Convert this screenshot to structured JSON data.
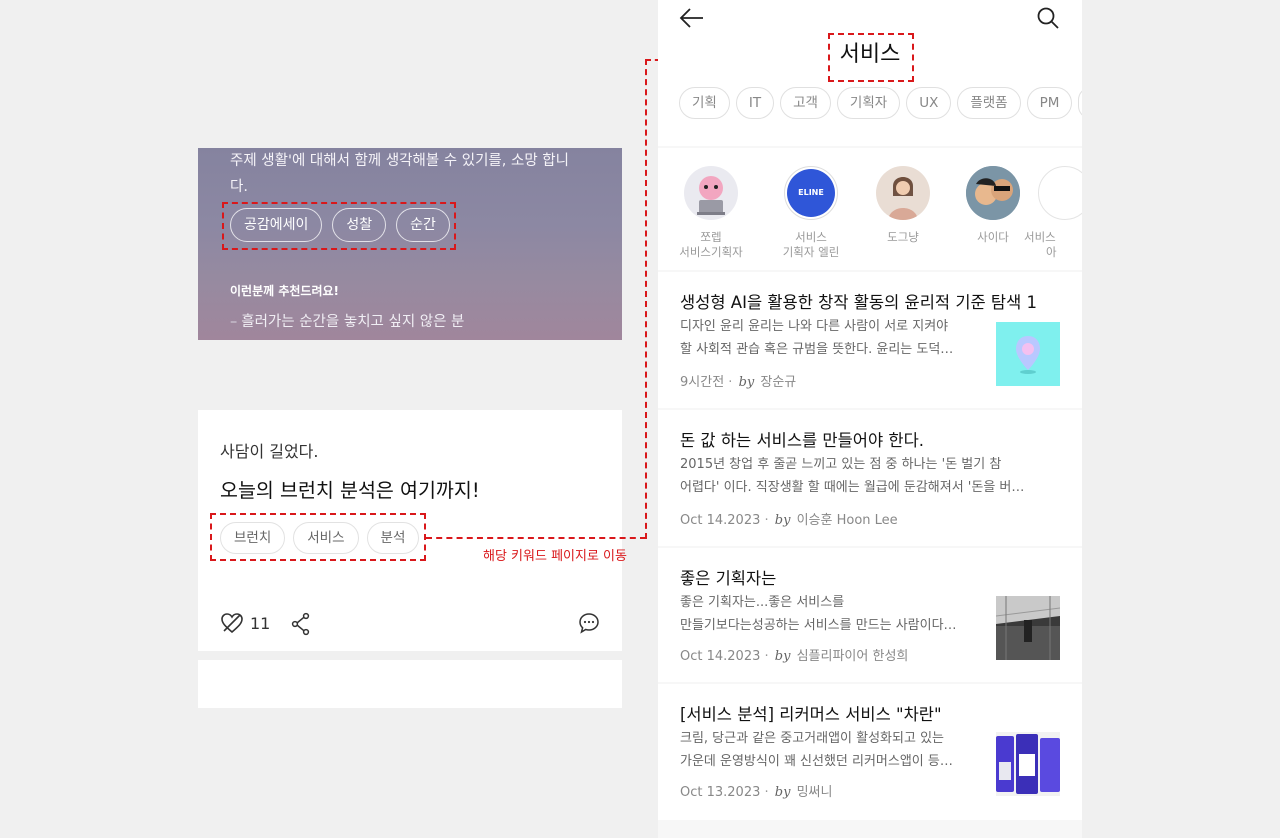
{
  "left_top_card": {
    "body_line1": "주제 생활'에 대해서 함께 생각해볼 수 있기를, 소망 합니",
    "body_line2": "다.",
    "tags": [
      "공감에세이",
      "성찰",
      "순간"
    ],
    "recommend_title": "이런분께 추천드려요!",
    "recommend_item": "흘러가는 순간을 놓치고 싶지 않은 분"
  },
  "left_bottom_card": {
    "subtitle": "사담이 길었다.",
    "title": "오늘의 브런치 분석은 여기까지!",
    "tags": [
      "브런치",
      "서비스",
      "분석"
    ],
    "like_count": "11"
  },
  "annotation": {
    "label": "해당 키워드 페이지로 이동",
    "color": "#d9181b"
  },
  "keyword_page": {
    "title": "서비스",
    "chips": [
      "기획",
      "IT",
      "고객",
      "기획자",
      "UX",
      "플랫폼",
      "PM",
      ""
    ],
    "writers": [
      {
        "line1": "쪼렙",
        "line2": "서비스기획자"
      },
      {
        "line1": "서비스",
        "line2": "기획자 엘린",
        "avatar_text": "ELINE"
      },
      {
        "line1": "도그냥",
        "line2": ""
      },
      {
        "line1": "사이다",
        "line2": ""
      },
      {
        "line1": "서비스",
        "line2": "아"
      }
    ],
    "articles": [
      {
        "title": "생성형 AI을 활용한  창작 활동의 윤리적 기준 탐색 1",
        "desc1": "디자인 윤리  윤리는 나와 다른 사람이 서로 지켜야",
        "desc2": "할 사회적 관습 혹은 규범을 뜻한다. 윤리는 도덕…",
        "date": "9시간전",
        "by": "by",
        "author": "장순규"
      },
      {
        "title": "돈 값 하는 서비스를 만들어야 한다.",
        "desc1": "2015년 창업 후 줄곧 느끼고 있는 점 중 하나는 '돈 벌기 참",
        "desc2": "어렵다' 이다.  직장생활 할 때에는 월급에 둔감해져서 '돈을 버…",
        "date": "Oct 14.2023",
        "by": "by",
        "author": "이승훈 Hoon Lee"
      },
      {
        "title": "좋은 기획자는",
        "desc1": "좋은 기획자는...좋은 서비스를",
        "desc2": "만들기보다는성공하는 서비스를 만드는 사람이다…",
        "date": "Oct 14.2023",
        "by": "by",
        "author": "심플리파이어 한성희"
      },
      {
        "title": "[서비스 분석] 리커머스 서비스 \"차란\"",
        "desc1": "크림, 당근과 같은 중고거래앱이 활성화되고 있는",
        "desc2": "가운데 운영방식이 꽤 신선했던 리커머스앱이 등…",
        "date": "Oct 13.2023",
        "by": "by",
        "author": "밍써니"
      }
    ]
  }
}
